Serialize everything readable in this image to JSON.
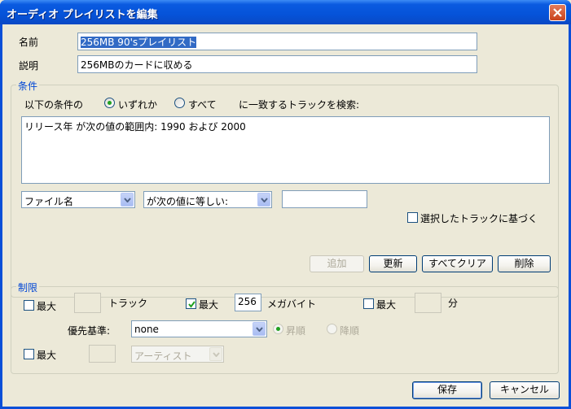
{
  "window": {
    "title": "オーディオ プレイリストを編集"
  },
  "fields": {
    "name_label": "名前",
    "name_value": "256MB  90'sプレイリスト",
    "desc_label": "説明",
    "desc_value": "256MBのカードに収める"
  },
  "conditions": {
    "group_title": "条件",
    "prefix": "以下の条件の",
    "radio_any": "いずれか",
    "radio_all": "すべて",
    "suffix": "に一致するトラックを検索:",
    "rules": [
      "リリース年 が次の値の範囲内: 1990 および 2000"
    ],
    "field_combo": "ファイル名",
    "operator_combo": "が次の値に等しい:",
    "value_input": "",
    "based_on_selected": "選択したトラックに基づく",
    "buttons": {
      "add": "追加",
      "update": "更新",
      "clear_all": "すべてクリア",
      "delete": "削除"
    }
  },
  "limits": {
    "group_title": "制限",
    "max_tracks_label": "最大",
    "max_tracks_value": "",
    "tracks_unit": "トラック",
    "max_mb_label": "最大",
    "max_mb_value": "256",
    "mb_unit": "メガバイト",
    "max_min_label": "最大",
    "max_min_value": "",
    "min_unit": "分",
    "priority_label": "優先基準:",
    "priority_value": "none",
    "ascending": "昇順",
    "descending": "降順",
    "max_artist_label": "最大",
    "max_artist_value": "",
    "artist_combo": "アーティスト"
  },
  "footer": {
    "save": "保存",
    "cancel": "キャンセル"
  }
}
